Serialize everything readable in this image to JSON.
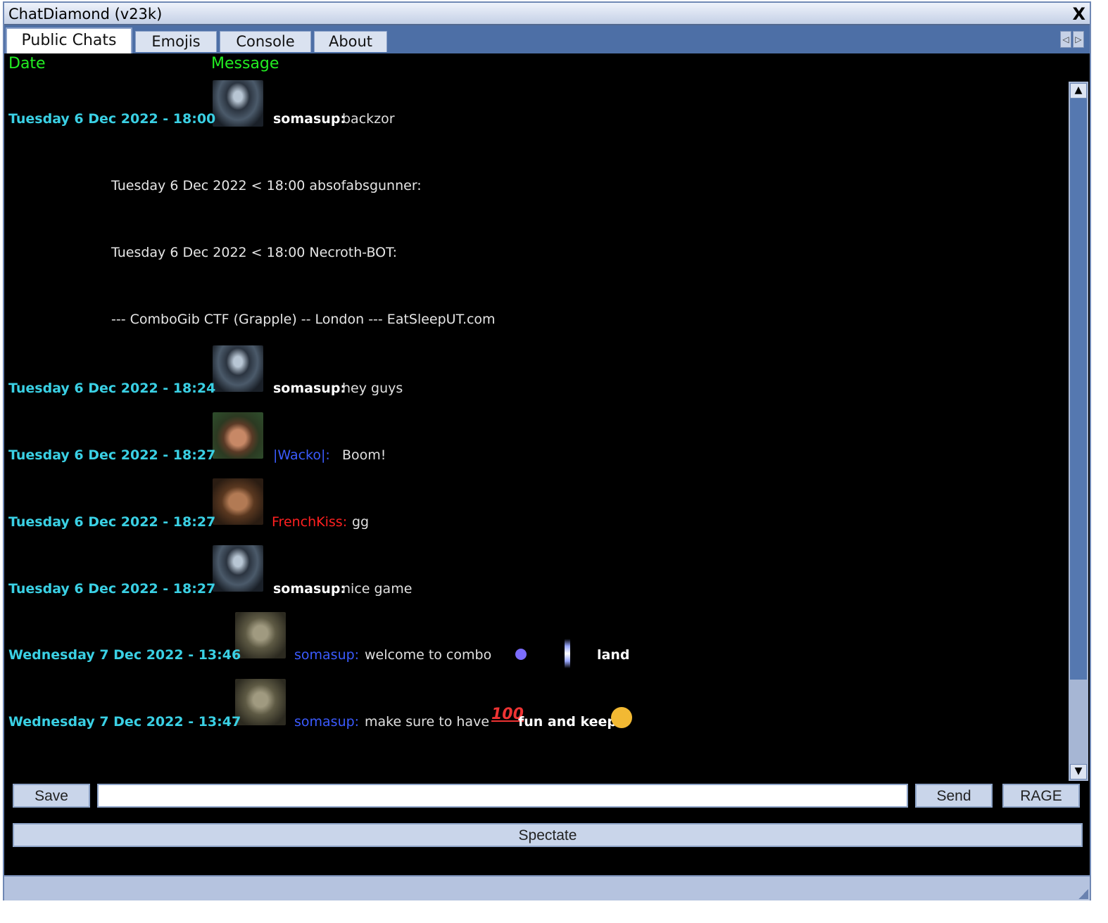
{
  "window": {
    "title": "ChatDiamond (v23k)",
    "close_label": "X"
  },
  "tabs": [
    {
      "label": "Public Chats",
      "active": true
    },
    {
      "label": "Emojis",
      "active": false
    },
    {
      "label": "Console",
      "active": false
    },
    {
      "label": "About",
      "active": false
    }
  ],
  "tab_scroll": {
    "left": "◁",
    "right": "▷"
  },
  "columns": {
    "date": "Date",
    "message": "Message"
  },
  "colors": {
    "date": "#3ad0e4",
    "header": "#22ee22",
    "name_white": "#ffffff",
    "name_blue": "#3b5bff",
    "name_red": "#ff2020"
  },
  "messages": [
    {
      "date": "Tuesday 6 Dec 2022 - 18:00",
      "avatar": "hooded-figure",
      "name": "somasup:",
      "name_color": "#ffffff",
      "text": "backzor"
    },
    {
      "meta": "Tuesday 6 Dec 2022 < 18:00  absofabsgunner:"
    },
    {
      "meta": "Tuesday 6 Dec 2022 < 18:00  Necroth-BOT:"
    },
    {
      "meta": " --- ComboGib CTF (Grapple) -- London --- EatSleepUT.com"
    },
    {
      "date": "Tuesday 6 Dec 2022 - 18:24",
      "avatar": "hooded-figure",
      "name": "somasup:",
      "name_color": "#ffffff",
      "text": "hey guys"
    },
    {
      "date": "Tuesday 6 Dec 2022 - 18:27",
      "avatar": "woman-green-beret",
      "name": "|Wacko|:",
      "name_color": "#3b5bff",
      "text": "Boom!"
    },
    {
      "date": "Tuesday 6 Dec 2022 - 18:27",
      "avatar": "man-face",
      "name": "FrenchKiss:",
      "name_color": "#ff2020",
      "text": "gg"
    },
    {
      "date": "Tuesday 6 Dec 2022 - 18:27",
      "avatar": "hooded-figure",
      "name": "somasup:",
      "name_color": "#ffffff",
      "text": "nice game"
    },
    {
      "date": "Wednesday 7 Dec 2022 - 13:46",
      "avatar": "ogre-face",
      "name": "somasup:",
      "name_color": "#3b5bff",
      "text": "welcome to combo",
      "text2": "land",
      "emojis": [
        "comet-icon",
        "light-beam-icon"
      ]
    },
    {
      "date": "Wednesday 7 Dec 2022 - 13:47",
      "avatar": "ogre-face",
      "name": "somasup:",
      "name_color": "#3b5bff",
      "text": "make sure to have",
      "text2": "fun and keep",
      "emojis": [
        "hundred-points-icon",
        "smirk-face-icon"
      ]
    }
  ],
  "hundred_glyph": "100",
  "input": {
    "value": ""
  },
  "buttons": {
    "save": "Save",
    "send": "Send",
    "rage": "RAGE",
    "spectate": "Spectate"
  },
  "scroll": {
    "up": "▲",
    "down": "▼"
  }
}
